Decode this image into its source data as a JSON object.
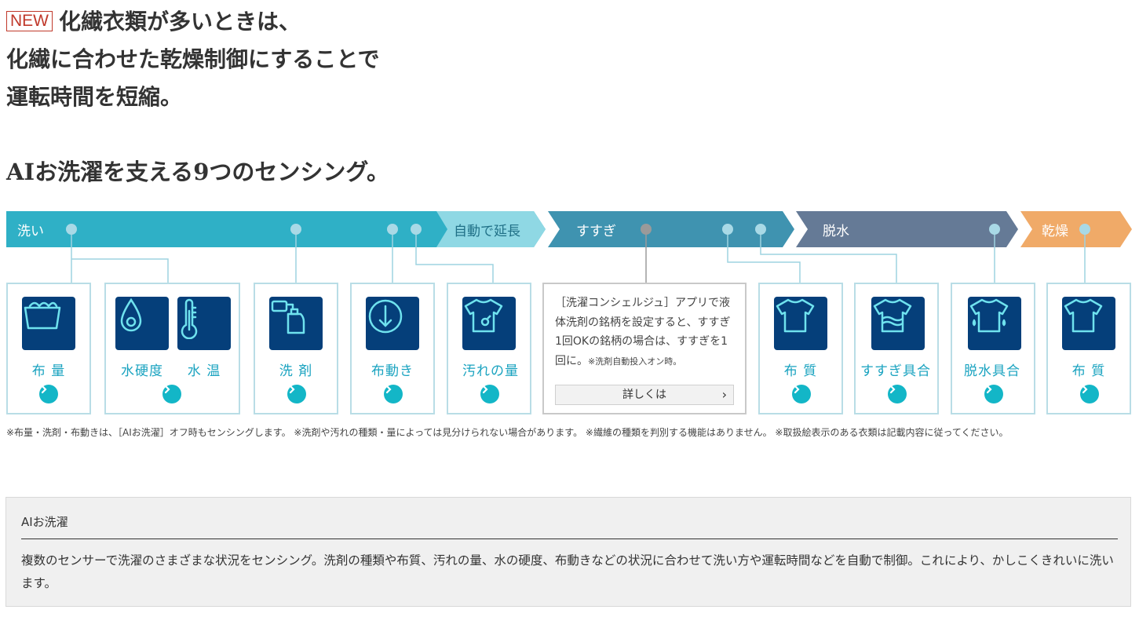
{
  "headline": {
    "badge": "NEW",
    "lines": [
      "化繊衣類が多いときは、",
      "化繊に合わせた乾燥制御にすることで",
      "運転時間を短縮。"
    ]
  },
  "subheading": "AIお洗濯を支える9つのセンシング。",
  "process": {
    "wash": "洗い",
    "extend": "自動で延長",
    "rinse": "すすぎ",
    "spin": "脱水",
    "dry": "乾燥"
  },
  "sensors": {
    "cloth_amount": {
      "label": "布 量",
      "icon": "laundry-tub-icon"
    },
    "water_hardness": {
      "label": "水硬度",
      "icon": "water-drop-icon"
    },
    "water_temp": {
      "label": "水 温",
      "icon": "thermometer-icon"
    },
    "detergent": {
      "label": "洗 剤",
      "icon": "detergent-bottle-icon"
    },
    "cloth_movement": {
      "label": "布動き",
      "icon": "rotation-arrow-icon"
    },
    "dirt_amount": {
      "label": "汚れの量",
      "icon": "stained-shirt-icon"
    },
    "fabric_rinse": {
      "label": "布 質",
      "icon": "shirt-icon"
    },
    "rinse_level": {
      "label": "すすぎ具合",
      "icon": "wet-shirt-icon"
    },
    "spin_level": {
      "label": "脱水具合",
      "icon": "dripping-shirt-icon"
    },
    "fabric_dry": {
      "label": "布 質",
      "icon": "shirt-icon"
    }
  },
  "concierge": {
    "text": "［洗濯コンシェルジュ］アプリで液体洗剤の銘柄を設定すると、すすぎ1回OKの銘柄の場合は、すすぎを1回に。",
    "note": "※洗剤自動投入オン時。",
    "button": "詳しくは"
  },
  "notes": "※布量・洗剤・布動きは、［AIお洗濯］オフ時もセンシングします。 ※洗剤や汚れの種類・量によっては見分けられない場合があります。 ※繊維の種類を判別する機能はありません。 ※取扱絵表示のある衣類は記載内容に従ってください。",
  "info": {
    "title": "AIお洗濯",
    "body": "複数のセンサーで洗濯のさまざまな状況をセンシング。洗剤の種類や布質、汚れの量、水の硬度、布動きなどの状況に合わせて洗い方や運転時間などを自動で制御。これにより、かしこくきれいに洗います。"
  },
  "colors": {
    "wash_band": "#2fb0c6",
    "extend_band": "#8fd8e4",
    "rinse_band": "#3f93b0",
    "spin_band": "#657a96",
    "dry_band": "#f0aa68",
    "icon_tile": "#053f7a",
    "accent": "#13b6c7",
    "badge": "#c0392b"
  }
}
